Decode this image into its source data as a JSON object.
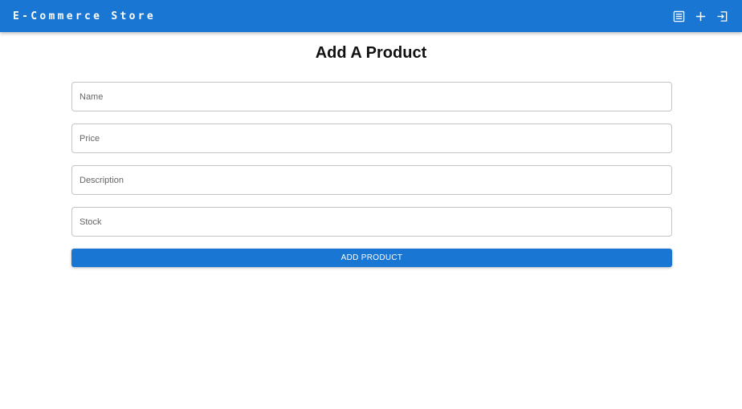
{
  "header": {
    "brand": "E-Commerce Store",
    "icons": [
      "product-list-icon",
      "add-icon",
      "login-icon"
    ]
  },
  "page": {
    "title": "Add A Product"
  },
  "form": {
    "name_placeholder": "Name",
    "name_value": "",
    "price_placeholder": "Price",
    "price_value": "",
    "description_placeholder": "Description",
    "description_value": "",
    "stock_placeholder": "Stock",
    "stock_value": "",
    "submit_label": "ADD PRODUCT"
  },
  "colors": {
    "primary": "#1976d2",
    "background": "#ffffff",
    "input_border": "#c4c4c4"
  }
}
